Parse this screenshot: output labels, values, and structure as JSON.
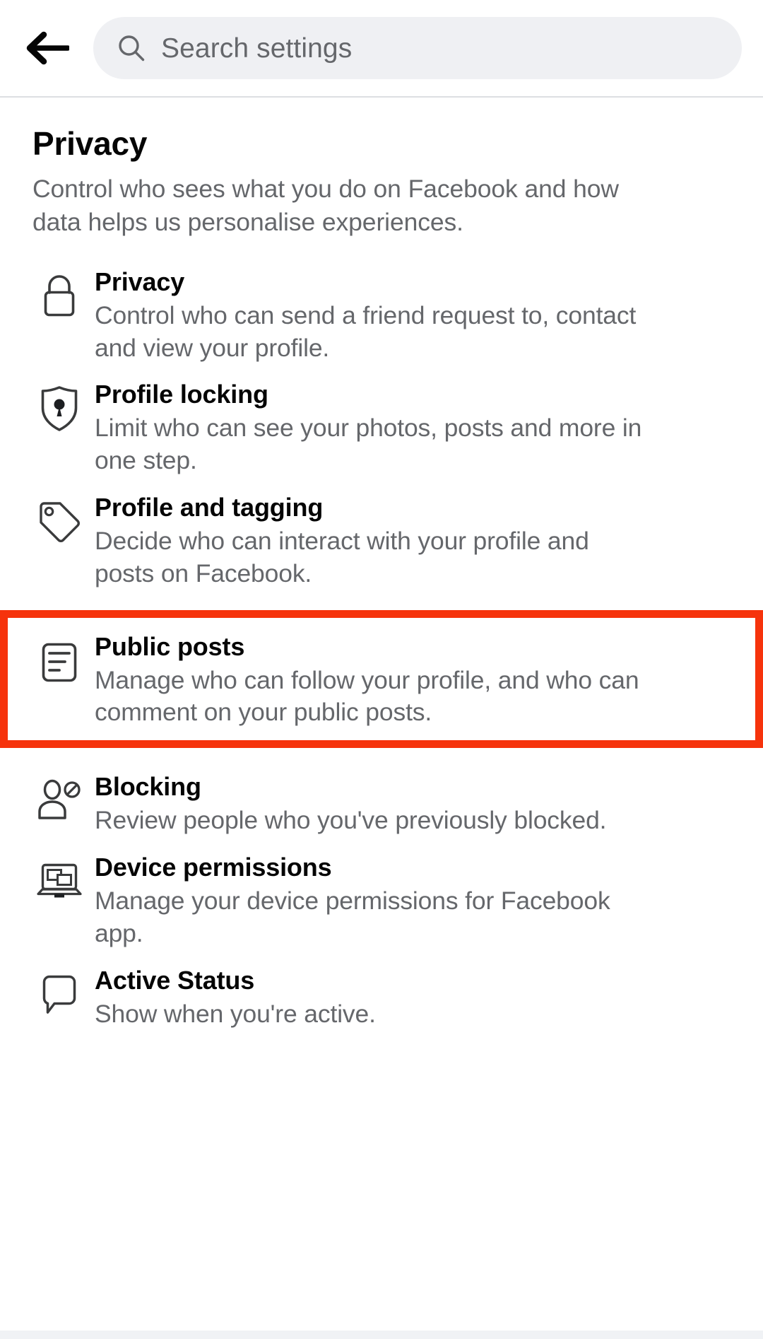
{
  "topbar": {
    "back_icon": "arrow-left-icon",
    "search": {
      "icon": "search-icon",
      "placeholder": "Search settings",
      "value": ""
    }
  },
  "page": {
    "title": "Privacy",
    "subtitle": "Control who sees what you do on Facebook and how data helps us personalise experiences."
  },
  "highlight": {
    "color": "#f6330c",
    "target": "Public posts"
  },
  "rows": [
    {
      "icon": "lock-icon",
      "title": "Privacy",
      "desc": "Control who can send a friend request to, contact and view your profile.",
      "highlighted": false
    },
    {
      "icon": "shield-keyhole-icon",
      "title": "Profile locking",
      "desc": "Limit who can see your photos, posts and more in one step.",
      "highlighted": false
    },
    {
      "icon": "tag-icon",
      "title": "Profile and tagging",
      "desc": "Decide who can interact with your profile and posts on Facebook.",
      "highlighted": false
    },
    {
      "icon": "post-lines-icon",
      "title": "Public posts",
      "desc": "Manage who can follow your profile, and who can comment on your public posts.",
      "highlighted": true
    },
    {
      "icon": "person-blocked-icon",
      "title": "Blocking",
      "desc": "Review people who you've previously blocked.",
      "highlighted": false
    },
    {
      "icon": "laptop-icon",
      "title": "Device permissions",
      "desc": "Manage your device permissions for Facebook app.",
      "highlighted": false
    },
    {
      "icon": "speech-bubble-icon",
      "title": "Active Status",
      "desc": "Show when you're active.",
      "highlighted": false
    }
  ],
  "colors": {
    "text_primary": "#050505",
    "text_secondary": "#65676b",
    "search_bg": "#eff0f3",
    "divider": "#dddfe2",
    "page_bg": "#ffffff",
    "bottom_strip": "#f0f2f5"
  }
}
